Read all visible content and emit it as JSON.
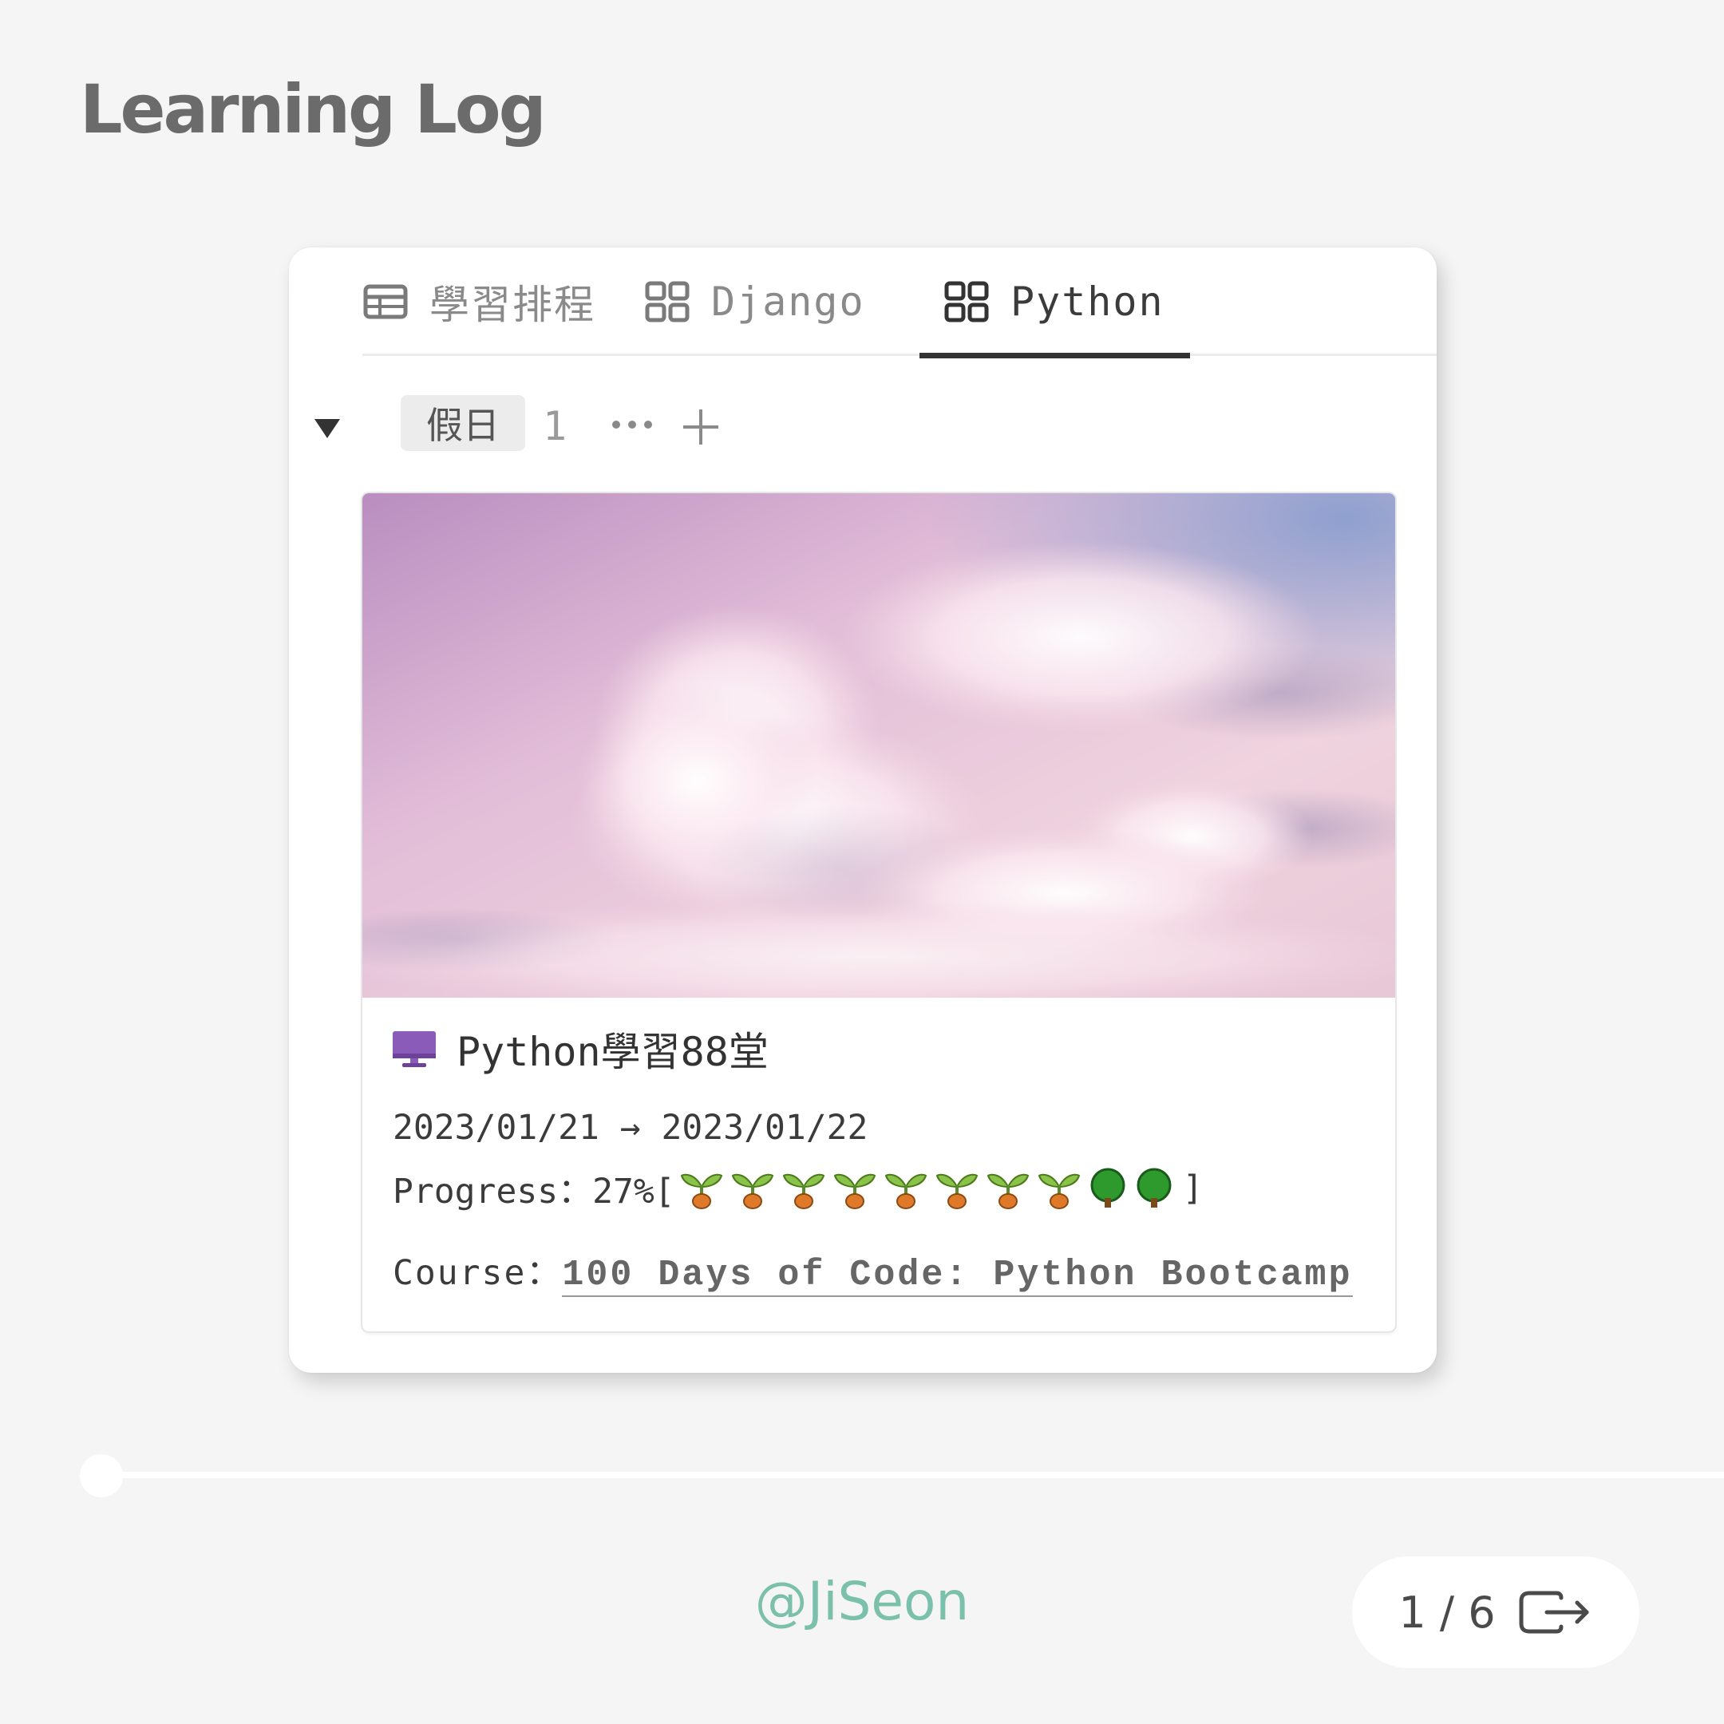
{
  "page": {
    "title": "Learning Log"
  },
  "tabs": [
    {
      "label": "學習排程",
      "icon": "table-icon",
      "active": false
    },
    {
      "label": "Django",
      "icon": "gallery-icon",
      "active": false
    },
    {
      "label": "Python",
      "icon": "gallery-icon",
      "active": true
    }
  ],
  "group": {
    "name": "假日",
    "count": "1",
    "collapse_icon": "triangle-down-icon",
    "more_icon": "more-icon",
    "add_icon": "plus-icon"
  },
  "card": {
    "cover": "pink-cloud-sky",
    "icon": "desktop-computer-icon",
    "title": "Python學習88堂",
    "dates": "2023/01/21 → 2023/01/22",
    "progress_label": "Progress：27%[",
    "progress_close": "]",
    "progress_value": 0.27,
    "progress_icons": [
      "seedling",
      "seedling",
      "seedling",
      "seedling",
      "seedling",
      "seedling",
      "seedling",
      "seedling",
      "tree",
      "tree"
    ],
    "course_label": "Course：",
    "course_value": "100 Days of Code: Python Bootcamp"
  },
  "timeline": {
    "position": 0
  },
  "footer": {
    "author": "@JiSeon",
    "pager": "1 / 6",
    "exit_icon": "exit-icon"
  },
  "colors": {
    "background": "#f5f5f5",
    "author": "#7bc0aa",
    "title": "#6b6b6b"
  }
}
